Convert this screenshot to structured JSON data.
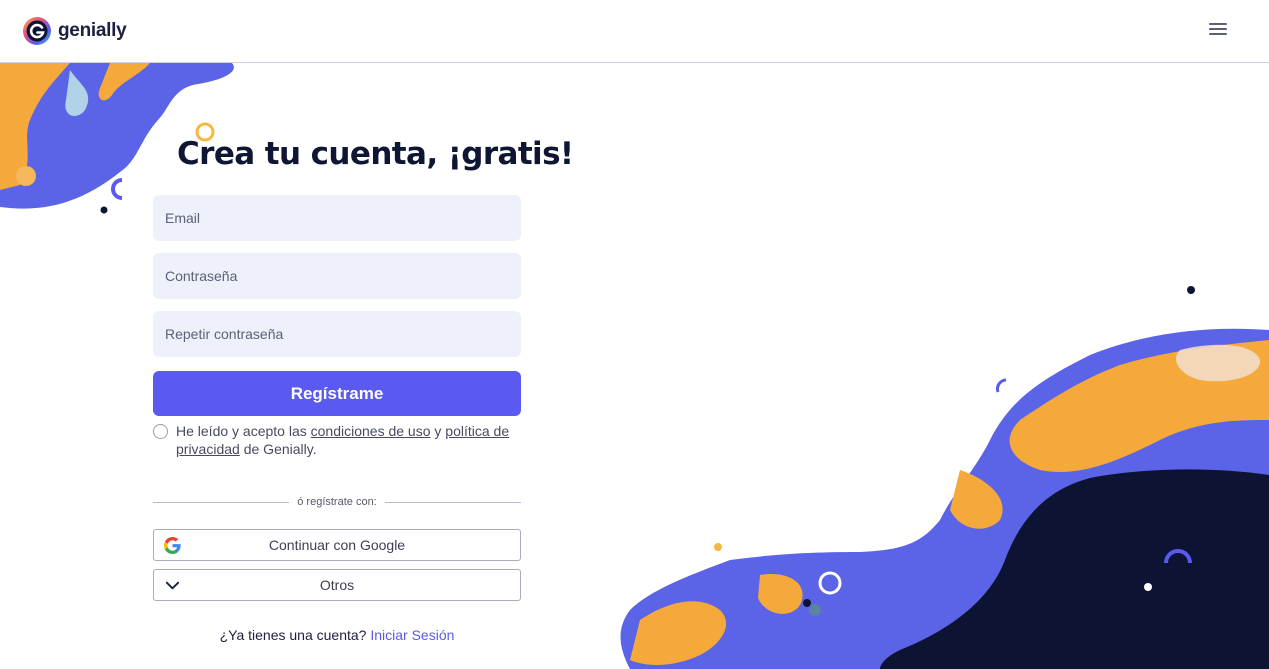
{
  "brand": {
    "name": "genially"
  },
  "header": {
    "menu_icon": "hamburger-menu-icon"
  },
  "form": {
    "title": "Crea tu cuenta, ¡gratis!",
    "email_placeholder": "Email",
    "password_placeholder": "Contraseña",
    "repeat_password_placeholder": "Repetir contraseña",
    "submit_label": "Regístrame",
    "consent": {
      "prefix": "He leído y acepto las ",
      "terms_link": "condiciones de uso",
      "connector": " y ",
      "privacy_link_part1": "política de",
      "privacy_link_part2": "privacidad",
      "suffix": " de Genially."
    },
    "divider_text": "ó regístrate con:",
    "google_label": "Continuar con Google",
    "others_label": "Otros",
    "login_prompt": "¿Ya tienes una cuenta?",
    "login_link": "Iniciar Sesión"
  },
  "colors": {
    "primary": "#5a5af0",
    "field_bg": "#eef0fa",
    "title": "#0f1634",
    "art_blue": "#5b63e6",
    "art_orange": "#f5a93b",
    "art_navy": "#0d1433"
  },
  "icons": [
    "genially-logo-icon",
    "hamburger-menu-icon",
    "google-icon",
    "chevron-down-icon"
  ]
}
